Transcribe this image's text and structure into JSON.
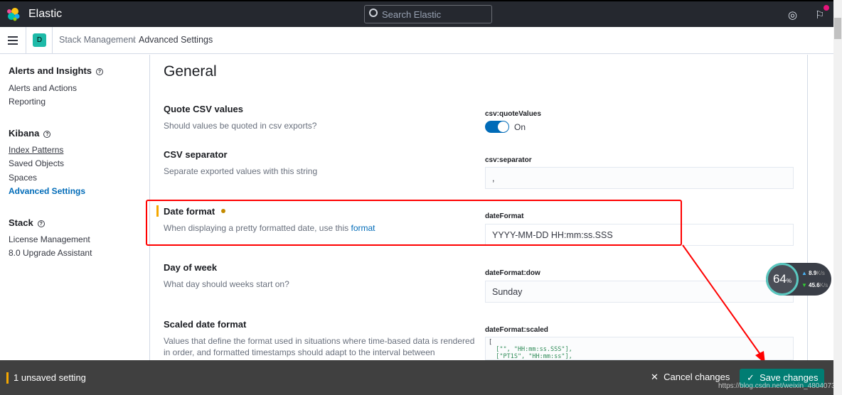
{
  "header": {
    "brand": "Elastic",
    "search_placeholder": "Search Elastic",
    "help_icon": "help-icon",
    "news_icon": "newsfeed-icon"
  },
  "breadcrumbs": {
    "space_initial": "D",
    "items": [
      "Stack Management",
      "Advanced Settings"
    ],
    "separator": "/"
  },
  "sidebar": {
    "sections": [
      {
        "title": "Alerts and Insights",
        "items": [
          "Alerts and Actions",
          "Reporting"
        ]
      },
      {
        "title": "Kibana",
        "items": [
          "Index Patterns",
          "Saved Objects",
          "Spaces",
          "Advanced Settings"
        ]
      },
      {
        "title": "Stack",
        "items": [
          "License Management",
          "8.0 Upgrade Assistant"
        ]
      }
    ],
    "active": "Advanced Settings"
  },
  "main": {
    "heading": "General",
    "settings": [
      {
        "title": "Quote CSV values",
        "description": "Should values be quoted in csv exports?",
        "key": "csv:quoteValues",
        "value": "On"
      },
      {
        "title": "CSV separator",
        "description": "Separate exported values with this string",
        "key": "csv:separator",
        "value": ","
      },
      {
        "title": "Date format",
        "description": "When displaying a pretty formatted date, use this",
        "link": "format",
        "key": "dateFormat",
        "value": "YYYY-MM-DD HH:mm:ss.SSS",
        "unsaved": true
      },
      {
        "title": "Day of week",
        "description": "What day should weeks start on?",
        "key": "dateFormat:dow",
        "value": "Sunday"
      },
      {
        "title": "Scaled date format",
        "description": "Values that define the format used in situations where time-based data is rendered in order, and formatted timestamps should adapt to the interval between",
        "key": "dateFormat:scaled",
        "code": [
          "[",
          "  [\"\", \"HH:mm:ss.SSS\"],",
          "  [\"PT1S\", \"HH:mm:ss\"],"
        ]
      }
    ]
  },
  "bottom_bar": {
    "unsaved": "1 unsaved setting",
    "cancel": "Cancel changes",
    "save": "Save changes"
  },
  "overlay": {
    "speed_percent": "64",
    "speed_unit": "%",
    "upload": "8.9",
    "download": "45.6",
    "rate_unit": "K/s",
    "watermark": "https://blog.csdn.net/weixin_4804073"
  },
  "colors": {
    "header": "#25282f",
    "accent": "#006bb8",
    "save": "#017d73",
    "unsaved": "#f5a700",
    "annotation": "#ff0000"
  }
}
